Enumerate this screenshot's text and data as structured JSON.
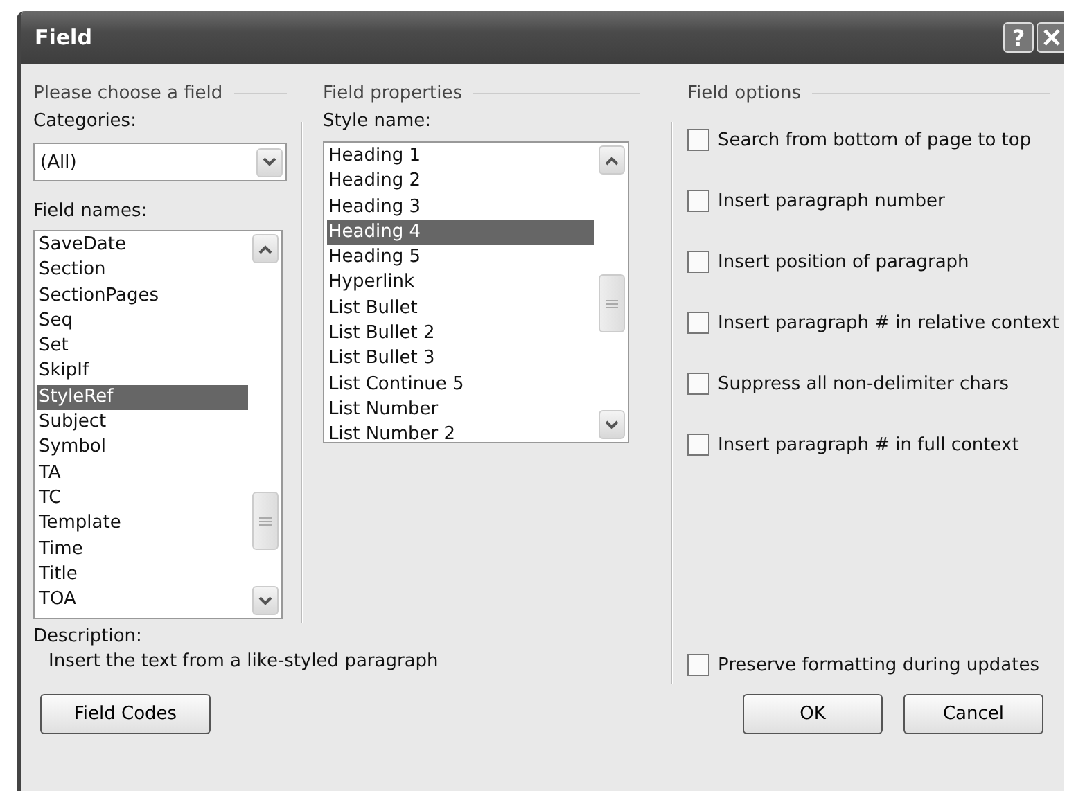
{
  "window": {
    "title": "Field",
    "help": "?"
  },
  "chooser": {
    "heading": "Please choose a field",
    "categories_label": "Categories:",
    "categories_value": "(All)",
    "field_names_label": "Field names:",
    "field_names": [
      {
        "label": "SaveDate",
        "selected": false
      },
      {
        "label": "Section",
        "selected": false
      },
      {
        "label": "SectionPages",
        "selected": false
      },
      {
        "label": "Seq",
        "selected": false
      },
      {
        "label": "Set",
        "selected": false
      },
      {
        "label": "SkipIf",
        "selected": false
      },
      {
        "label": "StyleRef",
        "selected": true
      },
      {
        "label": "Subject",
        "selected": false
      },
      {
        "label": "Symbol",
        "selected": false
      },
      {
        "label": "TA",
        "selected": false
      },
      {
        "label": "TC",
        "selected": false
      },
      {
        "label": "Template",
        "selected": false
      },
      {
        "label": "Time",
        "selected": false
      },
      {
        "label": "Title",
        "selected": false
      },
      {
        "label": "TOA",
        "selected": false
      }
    ]
  },
  "properties": {
    "heading": "Field properties",
    "style_name_label": "Style name:",
    "style_names": [
      {
        "label": "Heading 1",
        "selected": false
      },
      {
        "label": "Heading 2",
        "selected": false
      },
      {
        "label": "Heading 3",
        "selected": false
      },
      {
        "label": "Heading 4",
        "selected": true
      },
      {
        "label": "Heading 5",
        "selected": false
      },
      {
        "label": "Hyperlink",
        "selected": false
      },
      {
        "label": "List Bullet",
        "selected": false
      },
      {
        "label": "List Bullet 2",
        "selected": false
      },
      {
        "label": "List Bullet 3",
        "selected": false
      },
      {
        "label": "List Continue 5",
        "selected": false
      },
      {
        "label": "List Number",
        "selected": false
      },
      {
        "label": "List Number 2",
        "selected": false
      }
    ]
  },
  "options": {
    "heading": "Field options",
    "checkboxes": [
      {
        "label": "Search from bottom of page to top",
        "checked": false
      },
      {
        "label": "Insert paragraph number",
        "checked": false
      },
      {
        "label": "Insert position of paragraph",
        "checked": false
      },
      {
        "label": "Insert paragraph # in relative context",
        "checked": false
      },
      {
        "label": "Suppress all non-delimiter chars",
        "checked": false
      },
      {
        "label": "Insert paragraph # in full context",
        "checked": false
      }
    ],
    "preserve": {
      "label": "Preserve formatting during updates",
      "checked": false
    }
  },
  "description": {
    "label": "Description:",
    "text": "Insert the text from a like-styled paragraph"
  },
  "buttons": {
    "field_codes": "Field Codes",
    "ok": "OK",
    "cancel": "Cancel"
  }
}
